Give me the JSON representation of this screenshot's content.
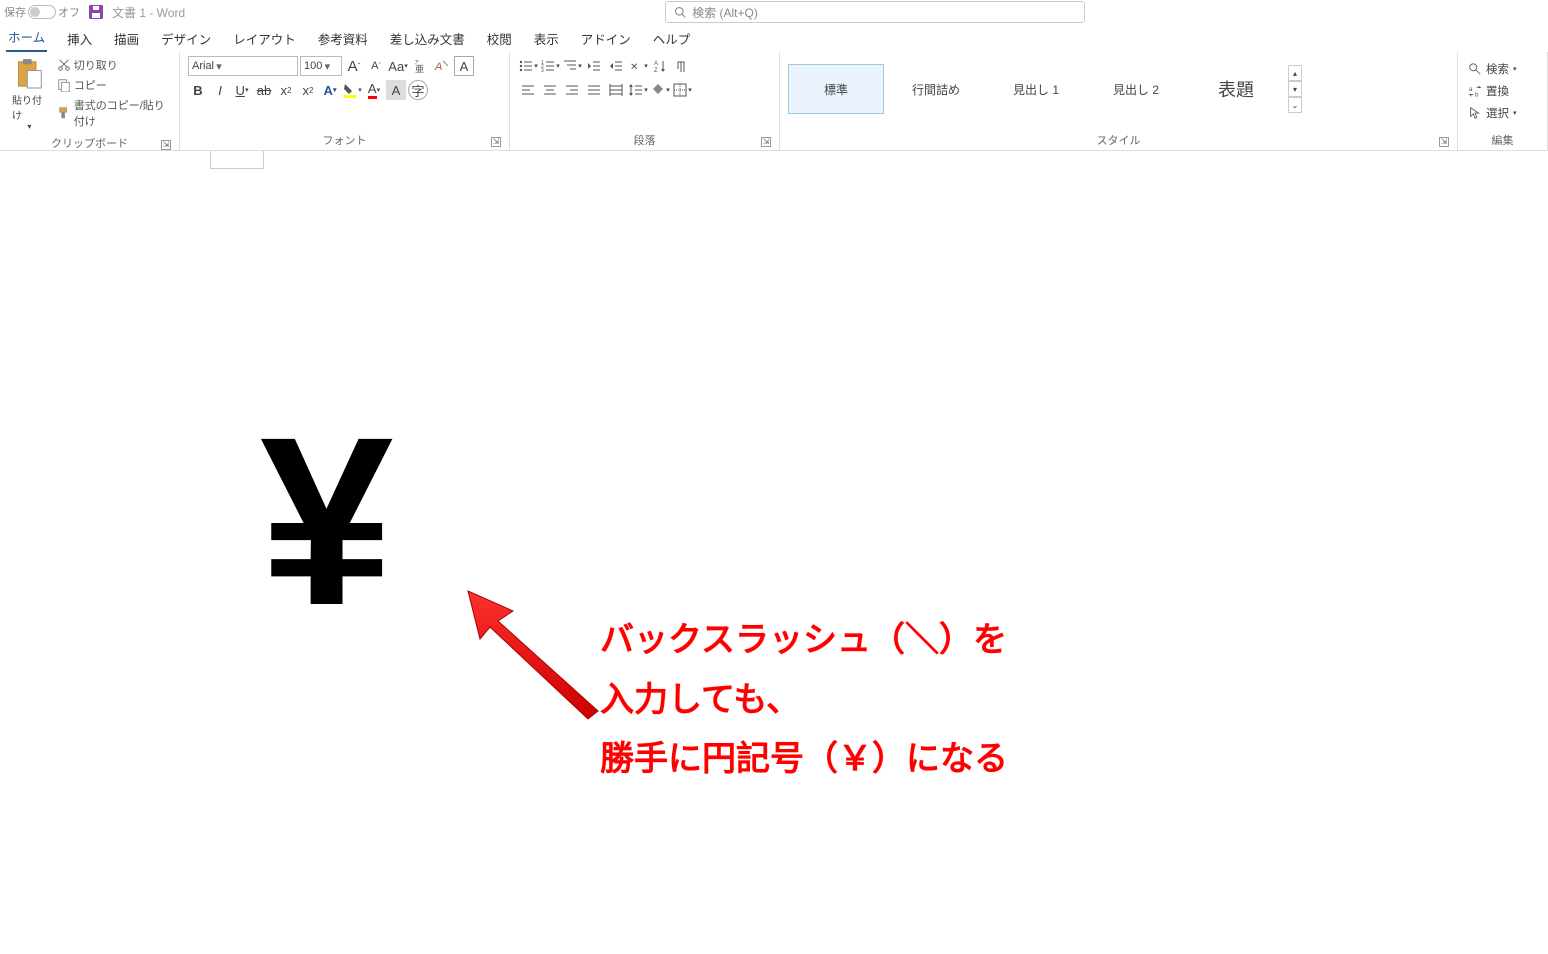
{
  "titlebar": {
    "autosave_label": "保存",
    "autosave_state": "オフ",
    "doc_title": "文書 1  -  Word"
  },
  "search": {
    "placeholder": "検索 (Alt+Q)"
  },
  "tabs": [
    "ホーム",
    "挿入",
    "描画",
    "デザイン",
    "レイアウト",
    "参考資料",
    "差し込み文書",
    "校閲",
    "表示",
    "アドイン",
    "ヘルプ"
  ],
  "active_tab": 0,
  "clipboard": {
    "paste": "貼り付け",
    "cut": "切り取り",
    "copy": "コピー",
    "format_painter": "書式のコピー/貼り付け",
    "group_label": "クリップボード"
  },
  "font": {
    "name": "Arial",
    "size": "100",
    "group_label": "フォント"
  },
  "paragraph": {
    "group_label": "段落"
  },
  "styles": {
    "items": [
      "標準",
      "行間詰め",
      "見出し 1",
      "見出し 2",
      "表題"
    ],
    "selected": 0,
    "group_label": "スタイル"
  },
  "editing": {
    "find": "検索",
    "replace": "置換",
    "select": "選択",
    "group_label": "編集"
  },
  "document": {
    "yen_char": "¥",
    "annotation": "バックスラッシュ（＼）を\n入力しても、\n勝手に円記号（￥）になる"
  }
}
